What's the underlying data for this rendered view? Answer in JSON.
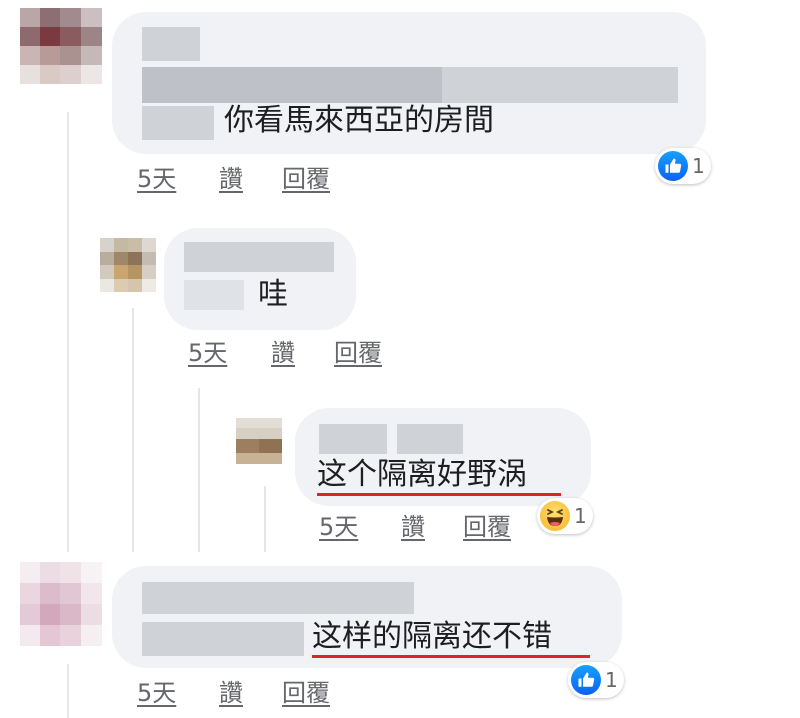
{
  "comments": [
    {
      "id": "c1",
      "text": "你看馬來西亞的房間",
      "time": "5天",
      "like": "讚",
      "reply": "回覆",
      "reaction_count": "1",
      "reaction": "like-icon"
    },
    {
      "id": "c2",
      "text": "哇",
      "time": "5天",
      "like": "讚",
      "reply": "回覆"
    },
    {
      "id": "c3",
      "text": "这个隔离好野涡",
      "time": "5天",
      "like": "讚",
      "reply": "回覆",
      "reaction_count": "1",
      "reaction": "haha-icon"
    },
    {
      "id": "c4",
      "text": "这样的隔离还不错",
      "time": "5天",
      "like": "讚",
      "reply": "回覆",
      "reaction_count": "1",
      "reaction": "like-icon"
    }
  ],
  "colors": {
    "bubble": "#f0f2f5",
    "like": "#1877f2",
    "highlight_underline": "#e0222a",
    "meta_text": "#65676b"
  }
}
